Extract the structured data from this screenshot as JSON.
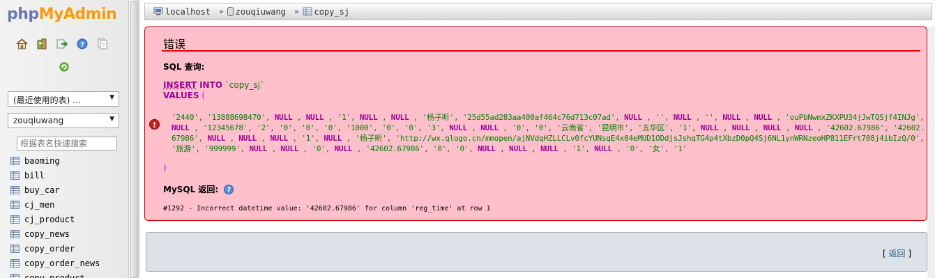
{
  "nav": {
    "logo": {
      "php": "php",
      "my": "My",
      "admin": "Admin"
    },
    "icons": [
      "home-icon",
      "database-icon",
      "logout-icon",
      "help-icon",
      "docs-icon",
      "reload-icon"
    ],
    "recent_select": "(最近使用的表) ...",
    "db_select": "zouqiuwang",
    "filter_placeholder": "根据表名快速搜索",
    "tables": [
      "baoming",
      "bill",
      "buy_car",
      "cj_men",
      "cj_product",
      "copy_news",
      "copy_order",
      "copy_order_news",
      "copy_product"
    ]
  },
  "breadcrumb": {
    "server": "localhost",
    "database": "zouqiuwang",
    "table": "copy_sj",
    "separator": "»"
  },
  "error": {
    "title": "错误",
    "sql_label": "SQL 查询:",
    "insert_kw": "INSERT",
    "into_kw": "INTO",
    "table_ident": "`copy_sj`",
    "values_kw": "VALUES",
    "open_paren": "(",
    "close_paren": ")",
    "values_text": "'2440', '13888698470', NULL , NULL , '1', NULL , NULL , '杨子昕', '25d55ad283aa400af464c76d713c07ad', NULL , '', NULL , '', NULL , NULL , 'ouPbNwmxZKXPU34jJwTQSjf4INJg', NULL , '12345678', '2', '0', '0', '0', '1000', '0', '0', '3', NULL , NULL , '0', '0', '云南省', '昆明市', '五华区', '1', NULL , NULL , NULL , NULL , '42602.67986', '42602.67986', NULL , NULL , NULL , '1', NULL , '杨子昕', 'http://wx.qlogo.cn/mmopen/ajNVdqHZLLCLv0fcYUNsqE4x04eMUD1ODdjsJshqTG4p4tXbzD0pQ4Sj6NL1ynWRNzeoHP811EFrt708j4ibIzQ/0', '旅游', '999999', NULL , NULL , '0', NULL , '42602.67986', '0', '0', NULL , NULL , NULL , '1', NULL , '0', '女', '1'",
    "mysql_label": "MySQL 返回:",
    "message": "#1292 - Incorrect datetime value: '42602.67986' for column 'reg_time' at row 1"
  },
  "back": {
    "open": "[",
    "label": "返回",
    "close": "]"
  },
  "colors": {
    "error_bg": "#ffc0cb",
    "error_border": "#cc0000",
    "keyword": "#990099",
    "string": "#008000",
    "link": "#235a81"
  }
}
